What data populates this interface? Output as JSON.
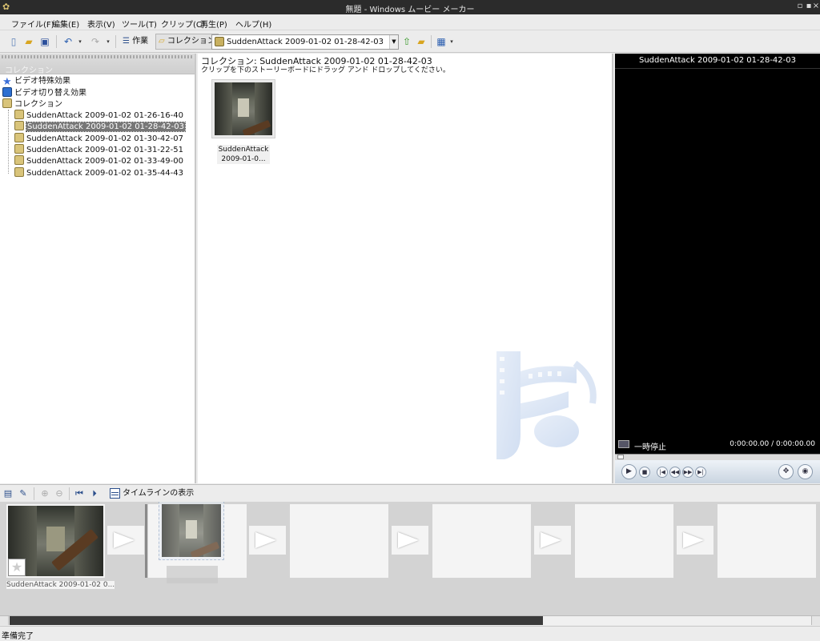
{
  "window": {
    "title": "無題 - Windows ムービー メーカー"
  },
  "menu": [
    "ファイル(F)",
    "編集(E)",
    "表示(V)",
    "ツール(T)",
    "クリップ(C)",
    "再生(P)",
    "ヘルプ(H)"
  ],
  "toolbar": {
    "tasks_label": "作業",
    "collections_label": "コレクション",
    "collection_combo_value": "SuddenAttack 2009-01-02 01-28-42-03"
  },
  "tree": {
    "header": "コレクション",
    "video_effects": "ビデオ特殊効果",
    "video_transitions": "ビデオ切り替え効果",
    "collections": "コレクション",
    "items": [
      "SuddenAttack 2009-01-02 01-26-16-40",
      "SuddenAttack 2009-01-02 01-28-42-03",
      "SuddenAttack 2009-01-02 01-30-42-07",
      "SuddenAttack 2009-01-02 01-31-22-51",
      "SuddenAttack 2009-01-02 01-33-49-00",
      "SuddenAttack 2009-01-02 01-35-44-43"
    ],
    "selected_index": 1
  },
  "content": {
    "title": "コレクション: SuddenAttack 2009-01-02 01-28-42-03",
    "hint": "クリップを下のストーリーボードにドラッグ アンド ドロップしてください。",
    "clip_caption_line1": "SuddenAttack",
    "clip_caption_line2": "2009-01-0..."
  },
  "preview": {
    "title": "SuddenAttack 2009-01-02 01-28-42-03",
    "state": "一時停止",
    "time": "0:00:00.00 / 0:00:00.00"
  },
  "storyboard": {
    "show_timeline_label": "タイムラインの表示",
    "clip1_caption": "SuddenAttack 2009-01-02 0..."
  },
  "status": {
    "text": "準備完了"
  },
  "colors": {
    "title_bar": "#2b2b2b",
    "selection": "#777777",
    "preview_bg": "#000000",
    "scroll_thumb": "#3a3a3a"
  }
}
